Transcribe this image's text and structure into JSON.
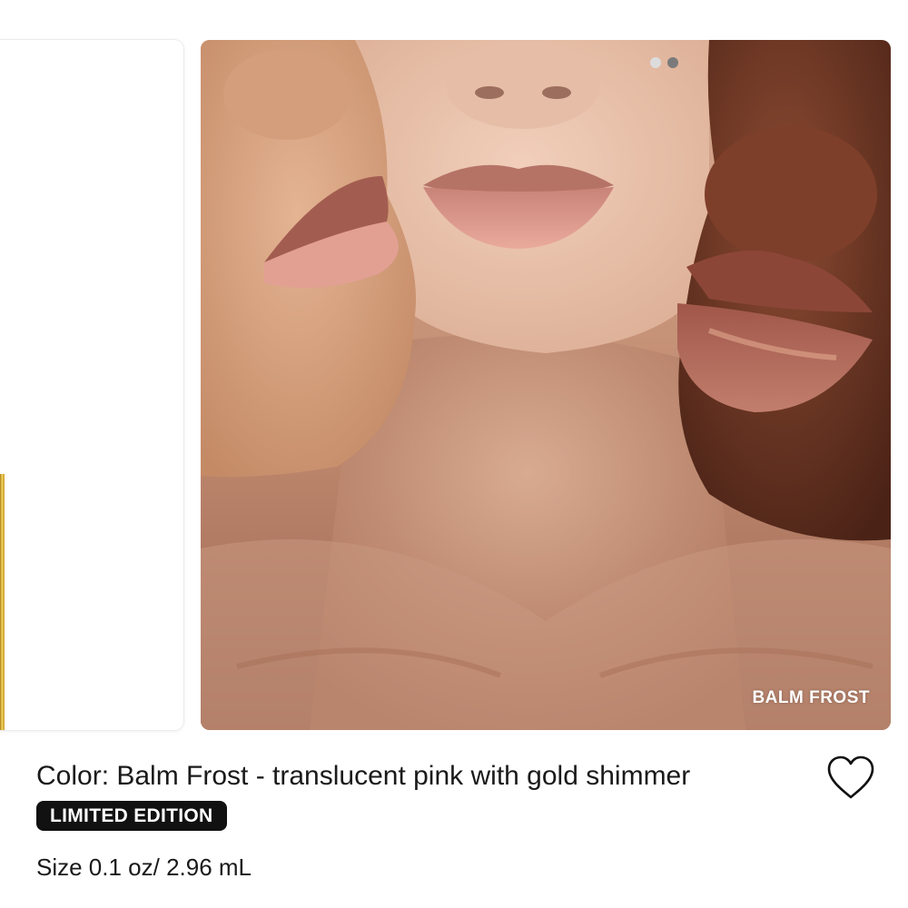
{
  "carousel": {
    "active_index": 2,
    "dot_count": 2,
    "slide_label": "BALM FROST"
  },
  "product": {
    "color_line": "Color: Balm Frost - translucent pink with gold shimmer",
    "badge": "LIMITED EDITION",
    "size_line": "Size 0.1 oz/ 2.96 mL"
  },
  "icons": {
    "favorite": "heart-outline-icon"
  },
  "colors": {
    "badge_bg": "#111111",
    "badge_text": "#ffffff",
    "text": "#1a1a1a",
    "dot_active": "#7b7b7b",
    "dot_inactive": "#dcdcdc"
  }
}
